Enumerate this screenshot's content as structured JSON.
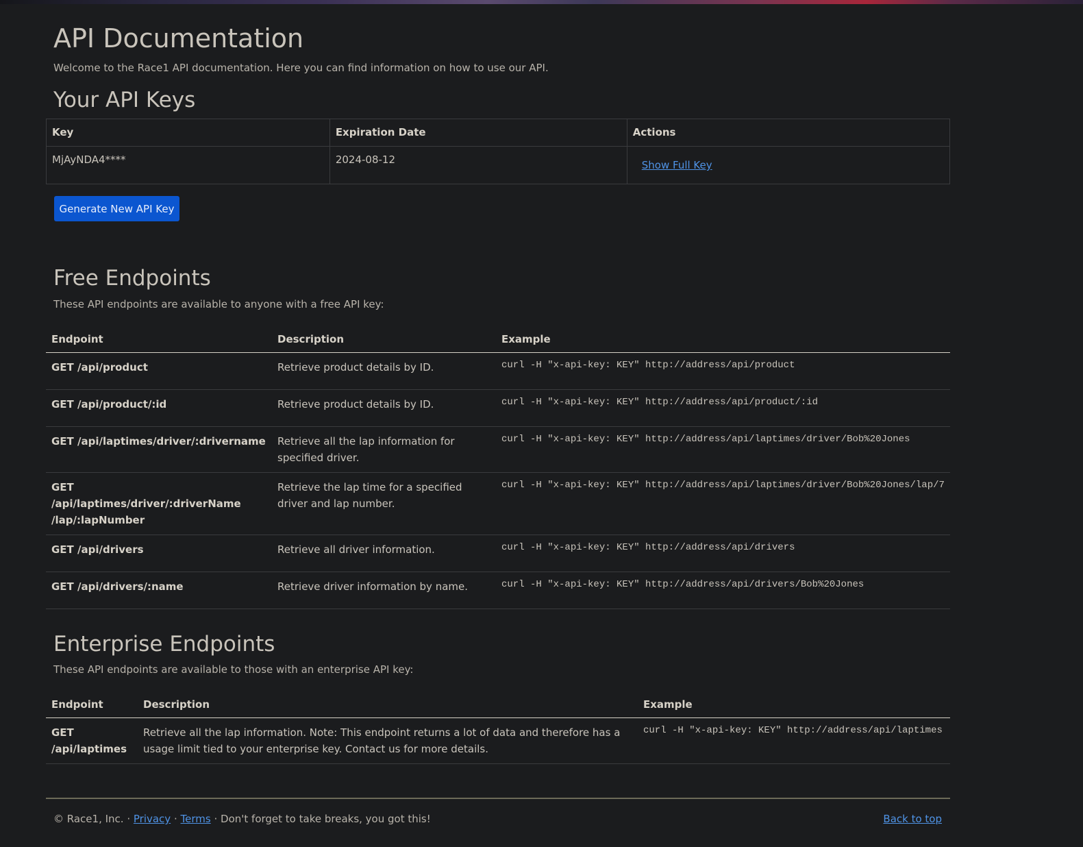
{
  "page": {
    "title": "API Documentation",
    "intro": "Welcome to the Race1 API documentation. Here you can find information on how to use our API."
  },
  "api_keys": {
    "heading": "Your API Keys",
    "columns": [
      "Key",
      "Expiration Date",
      "Actions"
    ],
    "rows": [
      {
        "key": "MjAyNDA4****",
        "expiration": "2024-08-12",
        "action": "Show Full Key"
      }
    ],
    "generate_button": "Generate New API Key"
  },
  "free": {
    "heading": "Free Endpoints",
    "lead": "These API endpoints are available to anyone with a free API key:",
    "columns": [
      "Endpoint",
      "Description",
      "Example"
    ],
    "rows": [
      {
        "endpoint": "GET /api/product",
        "description": "Retrieve product details by ID.",
        "example": "curl -H \"x-api-key: KEY\" http://address/api/product"
      },
      {
        "endpoint": "GET /api/product/:id",
        "description": "Retrieve product details by ID.",
        "example": "curl -H \"x-api-key: KEY\" http://address/api/product/:id"
      },
      {
        "endpoint": "GET /api/laptimes/driver/:drivername",
        "description": "Retrieve all the lap information for specified driver.",
        "example": "curl -H \"x-api-key: KEY\" http://address/api/laptimes/driver/Bob%20Jones"
      },
      {
        "endpoint": "GET /api/laptimes/driver/:driverName /lap/:lapNumber",
        "description": "Retrieve the lap time for a specified driver and lap number.",
        "example": "curl -H \"x-api-key: KEY\" http://address/api/laptimes/driver/Bob%20Jones/lap/7"
      },
      {
        "endpoint": "GET /api/drivers",
        "description": "Retrieve all driver information.",
        "example": "curl -H \"x-api-key: KEY\" http://address/api/drivers"
      },
      {
        "endpoint": "GET /api/drivers/:name",
        "description": "Retrieve driver information by name.",
        "example": "curl -H \"x-api-key: KEY\" http://address/api/drivers/Bob%20Jones"
      }
    ]
  },
  "enterprise": {
    "heading": "Enterprise Endpoints",
    "lead": "These API endpoints are available to those with an enterprise API key:",
    "columns": [
      "Endpoint",
      "Description",
      "Example"
    ],
    "rows": [
      {
        "endpoint": "GET /api/laptimes",
        "description": "Retrieve all the lap information. Note: This endpoint returns a lot of data and therefore has a usage limit tied to your enterprise key. Contact us for more details.",
        "example": "curl -H \"x-api-key: KEY\" http://address/api/laptimes"
      }
    ]
  },
  "footer": {
    "copyright": "© Race1, Inc. ·",
    "privacy": "Privacy",
    "sep": "·",
    "terms": "Terms",
    "tagline": "· Don't forget to take breaks, you got this!",
    "back_to_top": "Back to top"
  }
}
